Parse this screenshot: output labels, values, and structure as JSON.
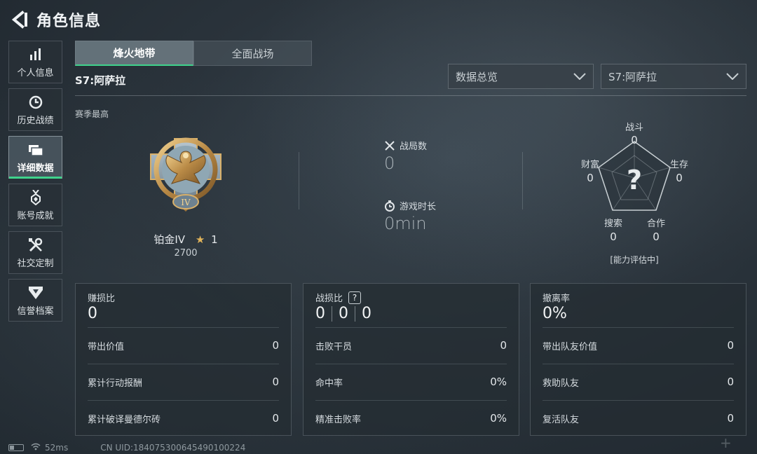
{
  "header": {
    "title": "角色信息"
  },
  "sidebar": {
    "items": [
      {
        "label": "个人信息",
        "icon": "bar-chart-icon"
      },
      {
        "label": "历史战绩",
        "icon": "clock-icon"
      },
      {
        "label": "详细数据",
        "icon": "folder-icon",
        "active": true
      },
      {
        "label": "账号成就",
        "icon": "medal-icon"
      },
      {
        "label": "社交定制",
        "icon": "tools-icon"
      },
      {
        "label": "信誉档案",
        "icon": "shield-icon"
      }
    ]
  },
  "tabs": [
    {
      "label": "烽火地带",
      "active": true
    },
    {
      "label": "全面战场",
      "active": false
    }
  ],
  "season": {
    "title": "S7:阿萨拉",
    "section_label": "赛季最高"
  },
  "filters": {
    "view": "数据总览",
    "season": "S7:阿萨拉"
  },
  "rank": {
    "name": "铂金IV",
    "stars": "1",
    "points": "2700",
    "emblem_numeral": "IV"
  },
  "summary": {
    "matches_label": "战局数",
    "matches_value": "0",
    "time_label": "游戏时长",
    "time_value": "0min"
  },
  "radar": {
    "center": "?",
    "axes": [
      {
        "label": "战斗",
        "value": "0"
      },
      {
        "label": "生存",
        "value": "0"
      },
      {
        "label": "合作",
        "value": "0"
      },
      {
        "label": "搜索",
        "value": "0"
      },
      {
        "label": "财富",
        "value": "0"
      }
    ],
    "status": "[能力评估中]"
  },
  "cards": {
    "profit": {
      "title": "赚损比",
      "value": "0",
      "rows": [
        {
          "label": "带出价值",
          "value": "0"
        },
        {
          "label": "累计行动报酬",
          "value": "0"
        },
        {
          "label": "累计破译曼德尔砖",
          "value": "0"
        }
      ]
    },
    "kd": {
      "title": "战损比",
      "help": "?",
      "values": [
        "0",
        "0",
        "0"
      ],
      "rows": [
        {
          "label": "击败干员",
          "value": "0"
        },
        {
          "label": "命中率",
          "value": "0%"
        },
        {
          "label": "精准击败率",
          "value": "0%"
        }
      ]
    },
    "extract": {
      "title": "撤离率",
      "value": "0%",
      "rows": [
        {
          "label": "带出队友价值",
          "value": "0"
        },
        {
          "label": "救助队友",
          "value": "0"
        },
        {
          "label": "复活队友",
          "value": "0"
        }
      ]
    }
  },
  "footer": {
    "ping": "52ms",
    "uid": "CN UID:184075300645490100224"
  },
  "colors": {
    "accent": "#3fd38c",
    "gold": "#e3b55a"
  }
}
